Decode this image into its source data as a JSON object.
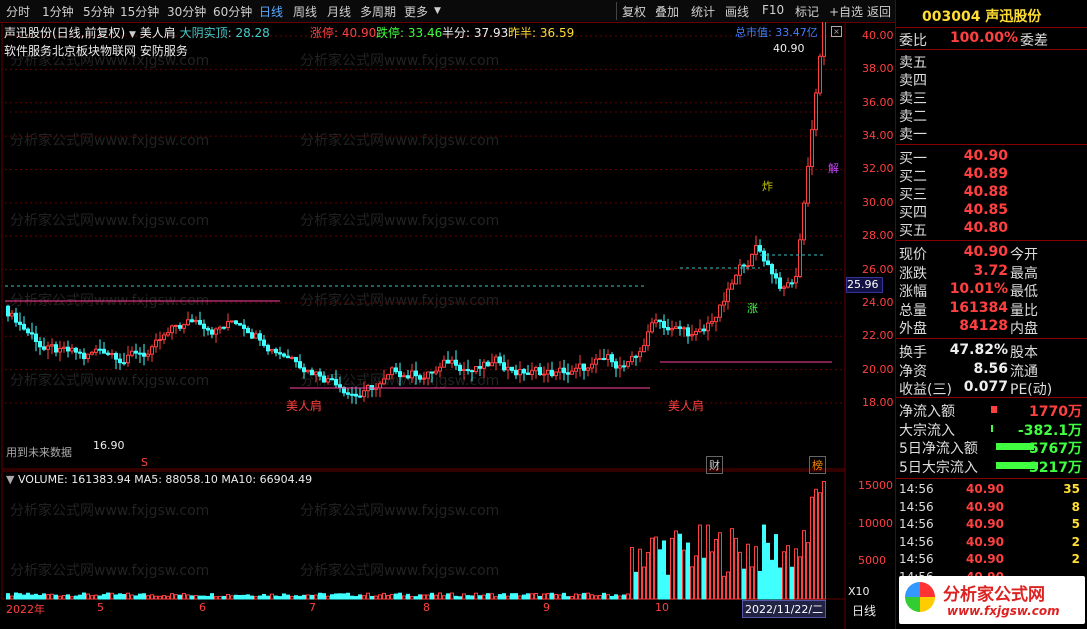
{
  "period_tabs": [
    "分时",
    "1分钟",
    "5分钟",
    "15分钟",
    "30分钟",
    "60分钟",
    "日线",
    "周线",
    "月线",
    "多周期",
    "更多"
  ],
  "right_tools": [
    "复权",
    "叠加",
    "统计",
    "画线",
    "F10",
    "标记",
    "+自选",
    "返回"
  ],
  "chart_header": {
    "name": "声迅股份(日线,前复权)",
    "indicator": "美人肩",
    "yinline": "大阴实顶: 28.28",
    "limit_up_label": "涨停: 40.90",
    "limit_down_label": "跌停: 33.46",
    "half_label": "半分: 37.93",
    "prev_half_label": "昨半: 36.59",
    "total_value_label": "总市值: 33.47亿"
  },
  "concepts": "软件服务北京板块物联网 安防服务",
  "y_axis": [
    "40.00",
    "38.00",
    "36.00",
    "34.00",
    "32.00",
    "30.00",
    "28.00",
    "26.00",
    "24.00",
    "22.00",
    "20.00",
    "18.00"
  ],
  "price_marker": "25.96",
  "annotations": {
    "high": "40.90",
    "low": "16.90",
    "pattern": "美人肩",
    "pattern2": "美人肩",
    "future": "用到未来数据",
    "zha": "炸",
    "zhang": "涨",
    "jie": "解",
    "cai": "财",
    "bang": "榜",
    "s": "S"
  },
  "volume_header": "VOLUME: 161383.94  MA5: 88058.10  MA10: 66904.49",
  "vol_axis": [
    "15000",
    "10000",
    "5000"
  ],
  "vol_unit": "X10",
  "date_axis": [
    "2022年",
    "5",
    "6",
    "7",
    "8",
    "9",
    "10"
  ],
  "current_date": "2022/11/22/二",
  "day_label": "日线",
  "stock_code": "003004 声迅股份",
  "order_ratio": {
    "label": "委比",
    "value": "100.00%",
    "label2": "委差"
  },
  "asks": [
    {
      "label": "卖五",
      "price": ""
    },
    {
      "label": "卖四",
      "price": ""
    },
    {
      "label": "卖三",
      "price": ""
    },
    {
      "label": "卖二",
      "price": ""
    },
    {
      "label": "卖一",
      "price": ""
    }
  ],
  "bids": [
    {
      "label": "买一",
      "price": "40.90"
    },
    {
      "label": "买二",
      "price": "40.89"
    },
    {
      "label": "买三",
      "price": "40.88"
    },
    {
      "label": "买四",
      "price": "40.85"
    },
    {
      "label": "买五",
      "price": "40.80"
    }
  ],
  "stats": [
    {
      "l": "现价",
      "v": "40.90",
      "l2": "今开"
    },
    {
      "l": "涨跌",
      "v": "3.72",
      "l2": "最高"
    },
    {
      "l": "涨幅",
      "v": "10.01%",
      "l2": "最低"
    },
    {
      "l": "总量",
      "v": "161384",
      "l2": "量比"
    },
    {
      "l": "外盘",
      "v": "84128",
      "l2": "内盘"
    }
  ],
  "stats2": [
    {
      "l": "换手",
      "v": "47.82%",
      "l2": "股本"
    },
    {
      "l": "净资",
      "v": "8.56",
      "l2": "流通"
    },
    {
      "l": "收益(三)",
      "v": "0.077",
      "l2": "PE(动)"
    }
  ],
  "flows": [
    {
      "l": "净流入额",
      "v": "1770万"
    },
    {
      "l": "大宗流入",
      "v": "-382.1万"
    },
    {
      "l": "5日净流入额",
      "v": "-5767万"
    },
    {
      "l": "5日大宗流入",
      "v": "-3217万"
    }
  ],
  "ticks": [
    {
      "t": "14:56",
      "p": "40.90",
      "q": "35"
    },
    {
      "t": "14:56",
      "p": "40.90",
      "q": "8"
    },
    {
      "t": "14:56",
      "p": "40.90",
      "q": "5"
    },
    {
      "t": "14:56",
      "p": "40.90",
      "q": "2"
    },
    {
      "t": "14:56",
      "p": "40.90",
      "q": "2"
    },
    {
      "t": "14:56",
      "p": "40.90",
      "q": ""
    }
  ],
  "logo": {
    "cn": "分析家公式网",
    "url": "www.fxjgsw.com"
  },
  "watermark": "分析家公式网www.fxjgsw.com"
}
